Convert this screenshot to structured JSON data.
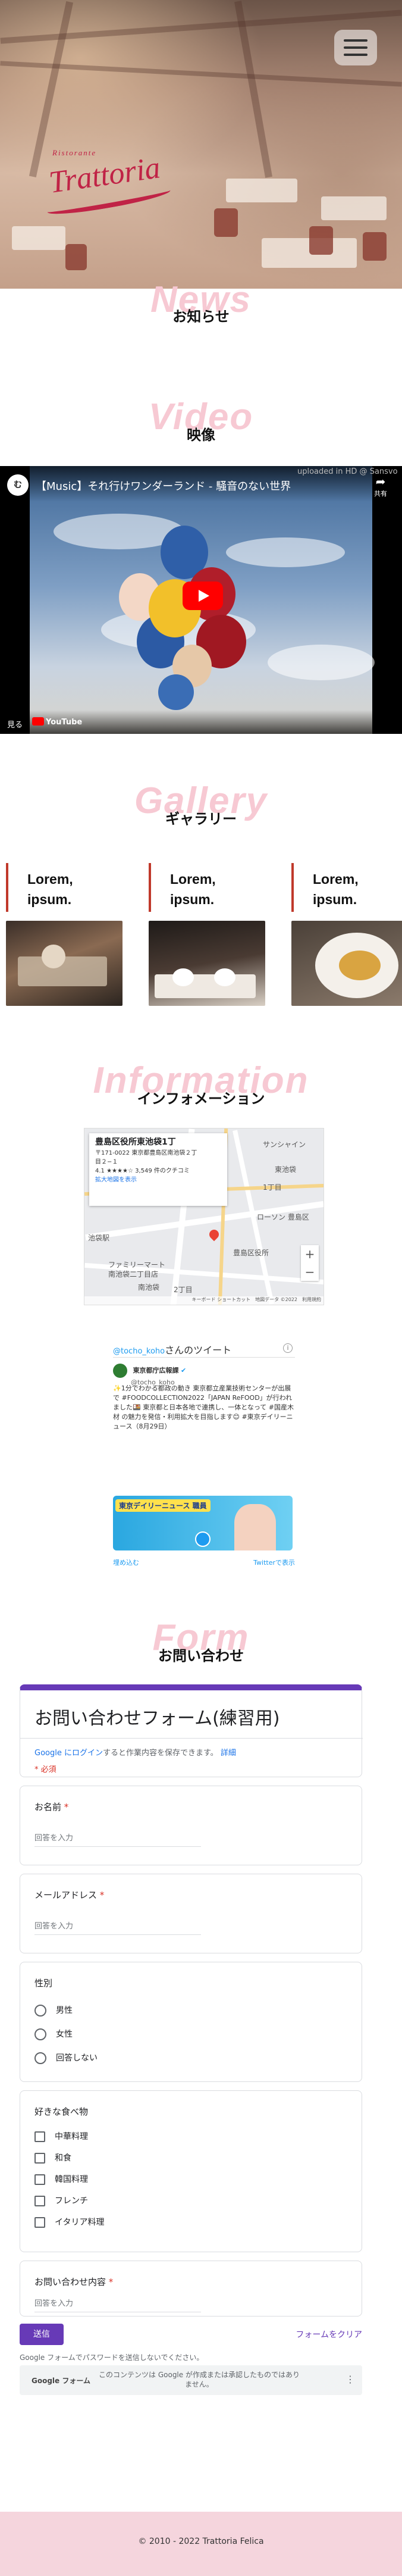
{
  "hero": {
    "logo_small": "Ristorante",
    "logo_main": "Trattoria"
  },
  "nav": {
    "menu_icon": "hamburger-menu-icon"
  },
  "sections": {
    "news": {
      "bg": "News",
      "title": "お知らせ"
    },
    "video": {
      "bg": "Video",
      "title": "映像"
    },
    "gallery": {
      "bg": "Gallery",
      "title": "ギャラリー"
    },
    "info": {
      "bg": "Information",
      "title": "インフォメーション"
    },
    "form": {
      "bg": "Form",
      "title": "お問い合わせ"
    }
  },
  "video": {
    "channel_avatar": "む",
    "title": "【Music】それ行けワンダーランド - 騒音のない世界",
    "share": "共有",
    "uploaded": "uploaded in HD @ Sansvo",
    "watch_on": "見る",
    "youtube": "YouTube"
  },
  "gallery": {
    "items": [
      {
        "line1": "Lorem,",
        "line2": "ipsum."
      },
      {
        "line1": "Lorem,",
        "line2": "ipsum."
      },
      {
        "line1": "Lorem,",
        "line2": "ipsum."
      }
    ]
  },
  "map": {
    "place": "豊島区役所東池袋1丁",
    "address1": "〒171-0022 東京都豊島区南池袋２丁",
    "address2": "目２−１",
    "rating": "4.1 ★★★★☆ 3,549 件のクチコミ",
    "enlarge": "拡大地図を表示",
    "labels": [
      "サンシャイン",
      "ローソン 豊島区",
      "池袋駅",
      "豊島区役所",
      "ファミリーマート",
      "南池袋二丁目店",
      "東池袋",
      "南池袋",
      "1丁目",
      "2丁目"
    ],
    "footer": "キーボード ショートカット　地図データ ©2022　利用規約"
  },
  "tweet": {
    "handle": "@tocho_koho",
    "header_suffix": "さんのツイート",
    "name": "東京都庁広報課",
    "user": "@tocho_koho",
    "body": "✨1分でわかる都政の動き 東京都立産業技術センターが出展で #FOODCOLLECTION2022「JAPAN ReFOOD」が行われました🍱 東京都と日本各地で連携し、一体となって #国産木材 の魅力を発信・利用拡大を目指します😊 #東京デイリーニュース（8月29日）",
    "image_text": "東京デイリーニュース 職員",
    "embed": "埋め込む",
    "view": "Twitterで表示"
  },
  "form": {
    "title": "お問い合わせフォーム(練習用)",
    "signin_link": "Google にログイン",
    "signin_rest": "すると作業内容を保存できます。",
    "signin_detail": "詳細",
    "required_note": "* 必須",
    "q_name": "お名前",
    "q_email": "メールアドレス",
    "q_gender": "性別",
    "gender_options": [
      "男性",
      "女性",
      "回答しない"
    ],
    "q_food": "好きな食べ物",
    "food_options": [
      "中華料理",
      "和食",
      "韓国料理",
      "フレンチ",
      "イタリア料理"
    ],
    "q_message": "お問い合わせ内容",
    "placeholder": "回答を入力",
    "submit": "送信",
    "clear": "フォームをクリア",
    "password_note": "Google フォームでパスワードを送信しないでください。",
    "footer_note": "このコンテンツは Google が作成または承認したものではありません。",
    "footer_brand": "Google フォーム"
  },
  "footer": {
    "copyright": "© 2010 - 2022 Trattoria Felica"
  }
}
